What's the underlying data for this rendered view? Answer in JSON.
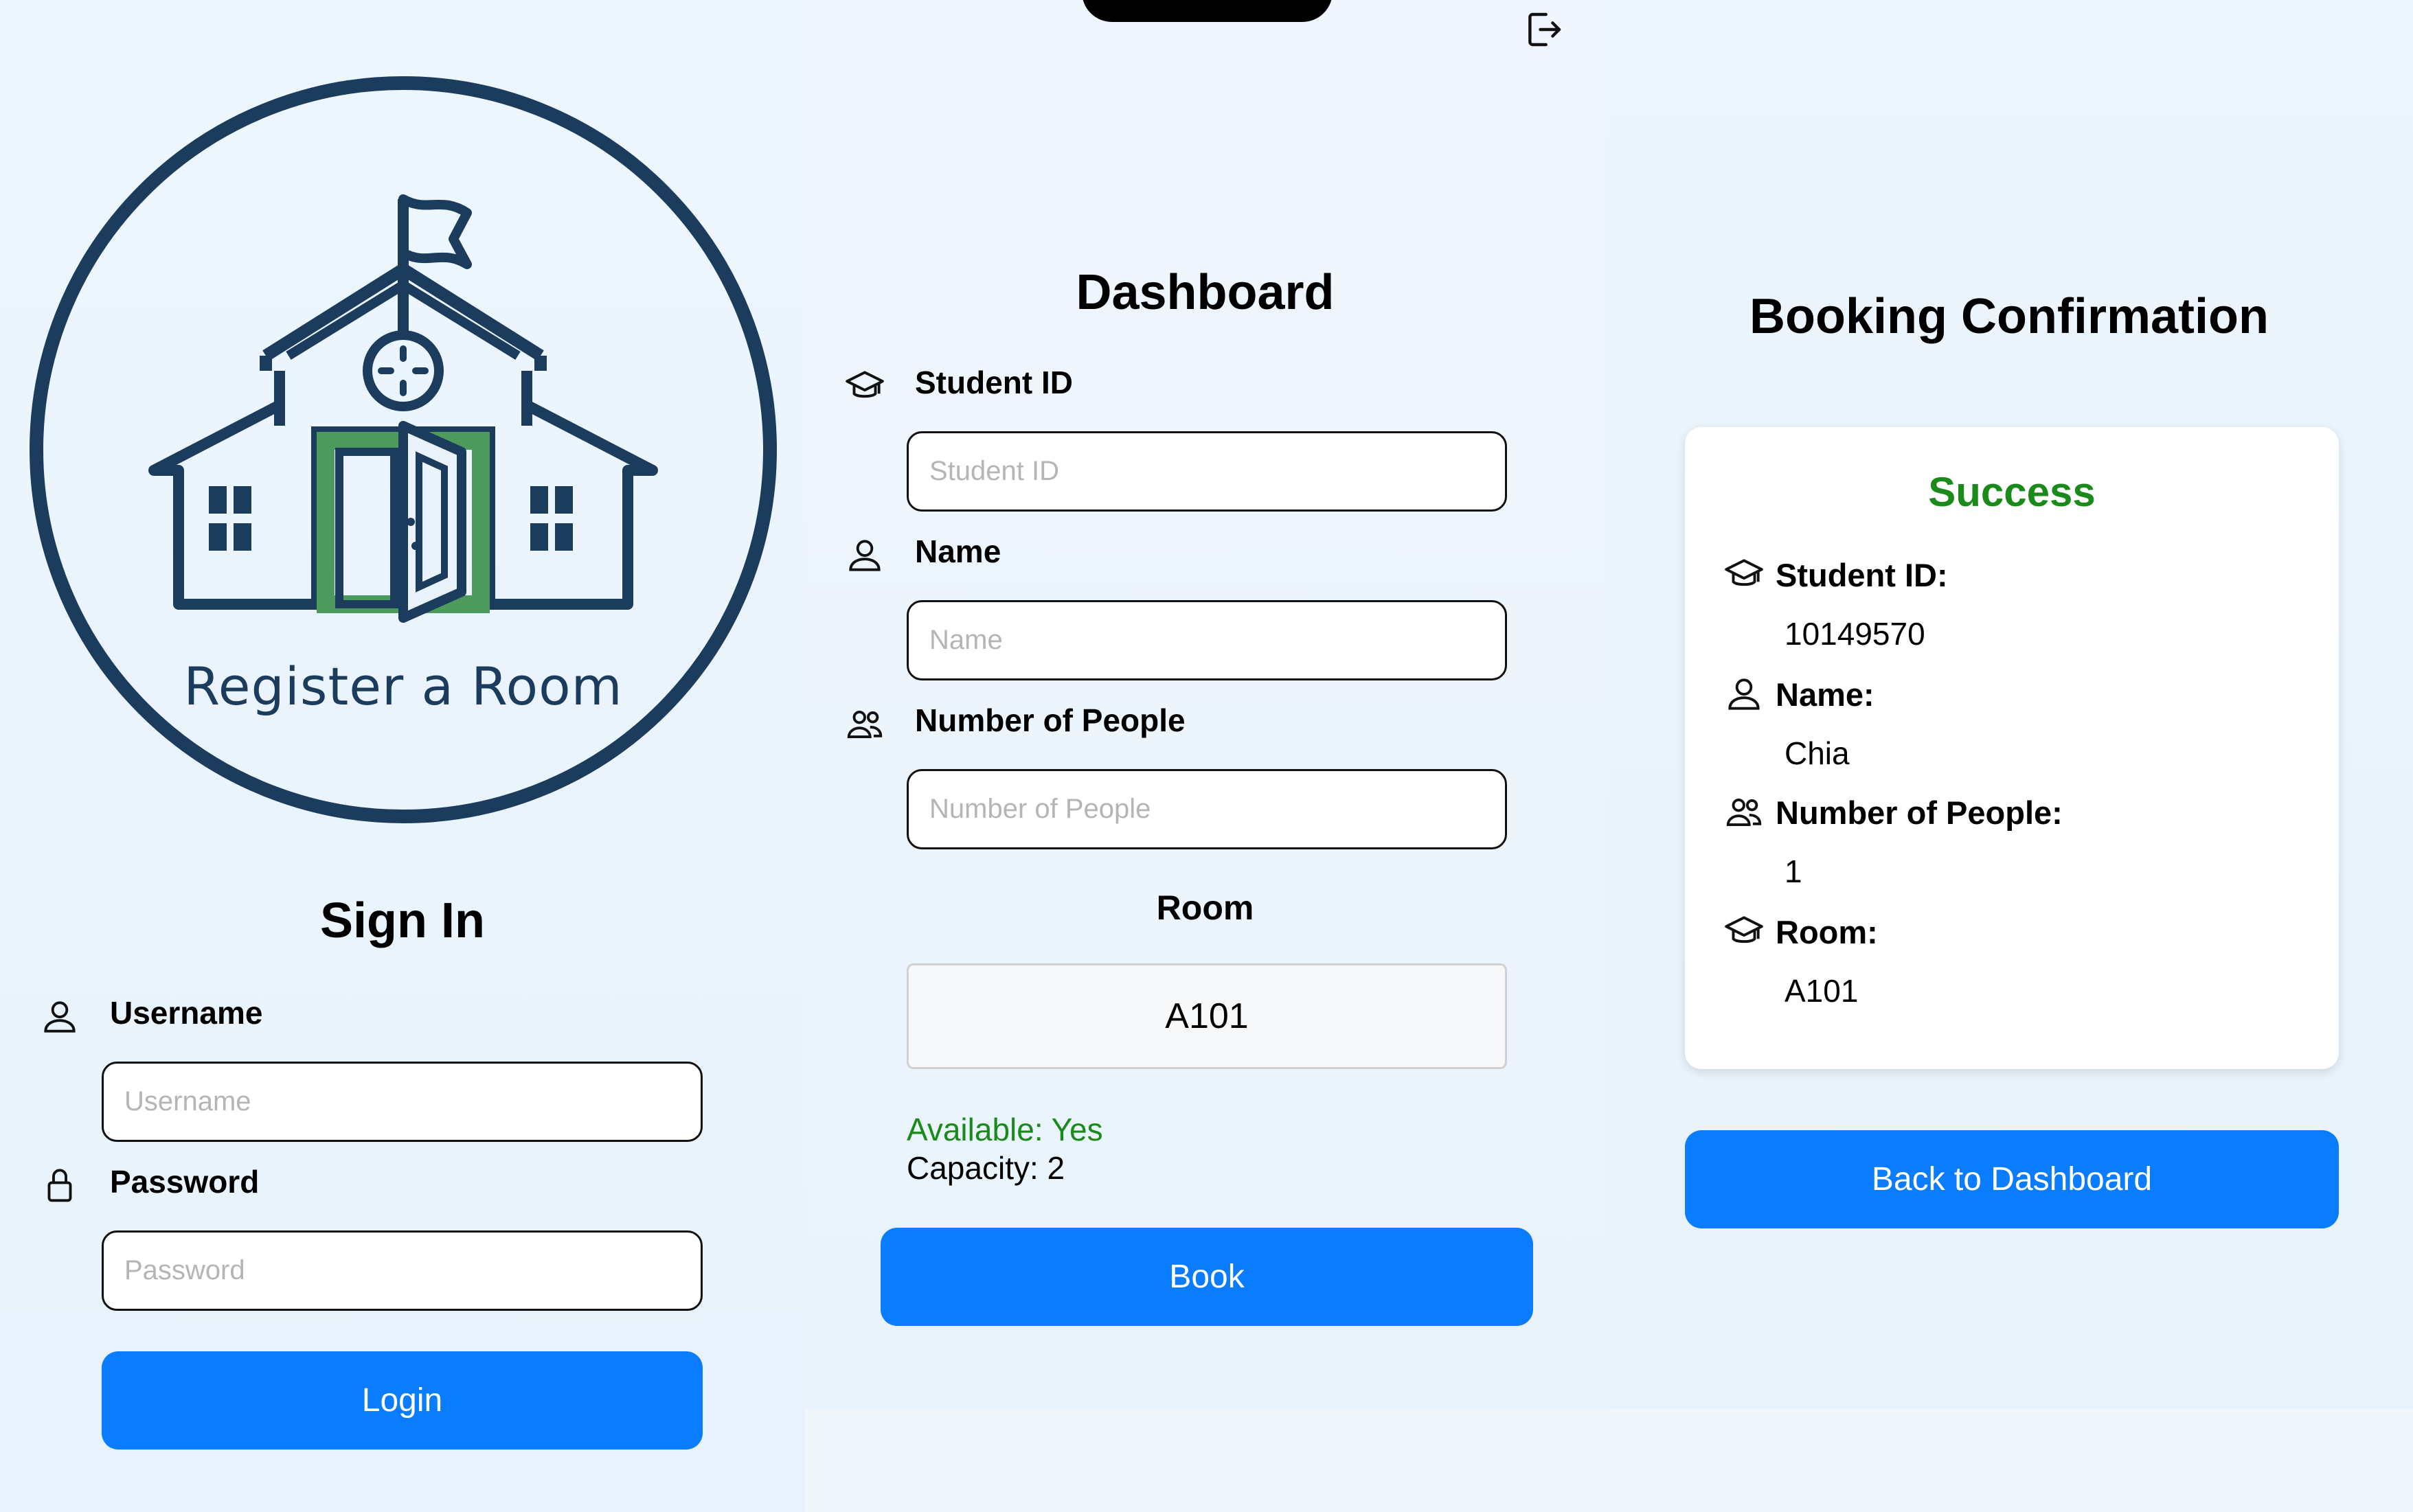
{
  "logo": {
    "text": "Register a Room",
    "color": "#1c3c5e",
    "accent": "#4c9a5e"
  },
  "signin": {
    "title": "Sign In",
    "username_label": "Username",
    "username_placeholder": "Username",
    "username_value": "",
    "password_label": "Password",
    "password_placeholder": "Password",
    "password_value": "",
    "login_label": "Login"
  },
  "dashboard": {
    "title": "Dashboard",
    "student_id_label": "Student ID",
    "student_id_placeholder": "Student ID",
    "name_label": "Name",
    "name_placeholder": "Name",
    "people_label": "Number of People",
    "people_placeholder": "Number of People",
    "room_label": "Room",
    "room_value": "A101",
    "available": "Available: Yes",
    "capacity": "Capacity: 2",
    "book_label": "Book"
  },
  "confirmation": {
    "title": "Booking Confirmation",
    "status": "Success",
    "student_id_label": "Student ID:",
    "student_id_value": "10149570",
    "name_label": "Name:",
    "name_value": "Chia",
    "people_label": "Number of People:",
    "people_value": "1",
    "room_label": "Room:",
    "room_value": "A101",
    "back_label": "Back to Dashboard"
  },
  "icons": {
    "student": "graduation-cap-icon",
    "person": "person-icon",
    "people": "people-icon",
    "lock": "lock-icon",
    "logout": "logout-icon"
  },
  "colors": {
    "primary": "#0a7cff",
    "success": "#1a8a1a",
    "background": "#eef5fc"
  }
}
